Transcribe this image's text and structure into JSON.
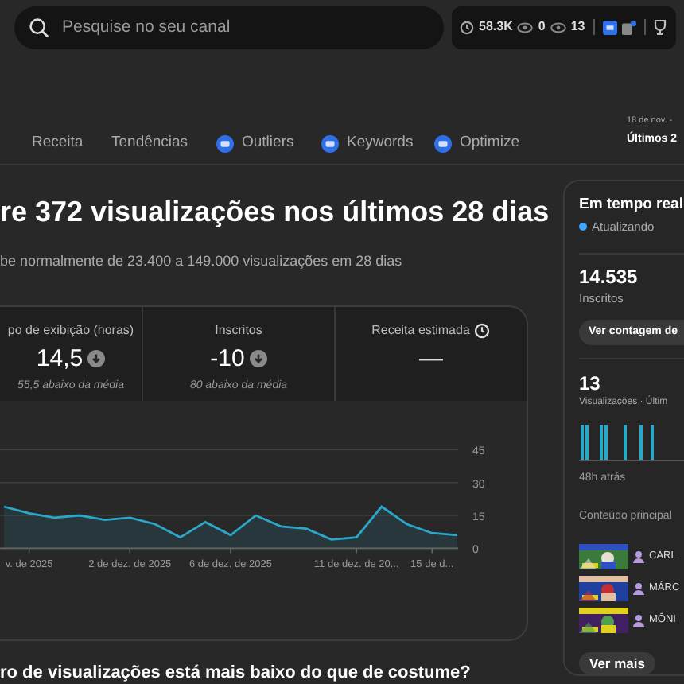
{
  "search": {
    "placeholder": "Pesquise no seu canal"
  },
  "stats": [
    {
      "kind": "clock",
      "value": "58.3K"
    },
    {
      "kind": "eye",
      "value": "0"
    },
    {
      "kind": "eye",
      "value": "13"
    }
  ],
  "tabs": [
    {
      "label": "Receita",
      "kind": "plain"
    },
    {
      "label": "Tendências",
      "kind": "plain"
    },
    {
      "label": "Outliers",
      "kind": "extension"
    },
    {
      "label": "Keywords",
      "kind": "extension"
    },
    {
      "label": "Optimize",
      "kind": "extension"
    }
  ],
  "date_range": {
    "dates": "18 de nov. -",
    "label": "Últimos 2"
  },
  "summary": {
    "title": "re 372 visualizações nos últimos 28 dias",
    "subtitle": "be normalmente de 23.400 a 149.000 visualizações em 28 dias"
  },
  "metrics": [
    {
      "label": "po de exibição (horas)",
      "value": "14,5",
      "kind": "below",
      "note": "55,5 abaixo da média"
    },
    {
      "label": "Inscritos",
      "value": "-10",
      "kind": "below",
      "note": "80 abaixo da média"
    },
    {
      "label": "Receita estimada",
      "value": "—",
      "kind": "pending"
    }
  ],
  "chart": {
    "chart_data": {
      "type": "area",
      "categories": [
        null,
        "v. de 2025",
        null,
        null,
        null,
        "2 de dez. de 2025",
        null,
        null,
        null,
        "6 de dez. de 2025",
        null,
        null,
        null,
        null,
        "11 de dez. de 20...",
        null,
        null,
        "15 de d...",
        null
      ],
      "series": [
        {
          "color": "#2aa7c9",
          "values": [
            19,
            16,
            14,
            15,
            13,
            14,
            11,
            5,
            12,
            6,
            15,
            10,
            9,
            4,
            5,
            19,
            11,
            7,
            6
          ]
        }
      ],
      "ylim": [
        0,
        45
      ],
      "yticks": [
        0,
        15,
        30,
        45
      ]
    }
  },
  "question": "ro de visualizações está mais baixo do que de costume?",
  "realtime": {
    "title": "Em tempo real",
    "status": "Atualizando",
    "subscribers": "14.535",
    "subscribers_label": "Inscritos",
    "count_button": "Ver contagem de",
    "views": "13",
    "views_label": "Visualizações · Últim",
    "time_label": "48h atrás",
    "top_content_label": "Conteúdo principal",
    "top_content": [
      {
        "name": "CARL"
      },
      {
        "name": "MÁRC"
      },
      {
        "name": "MÔNI"
      }
    ],
    "more_button": "Ver mais"
  }
}
